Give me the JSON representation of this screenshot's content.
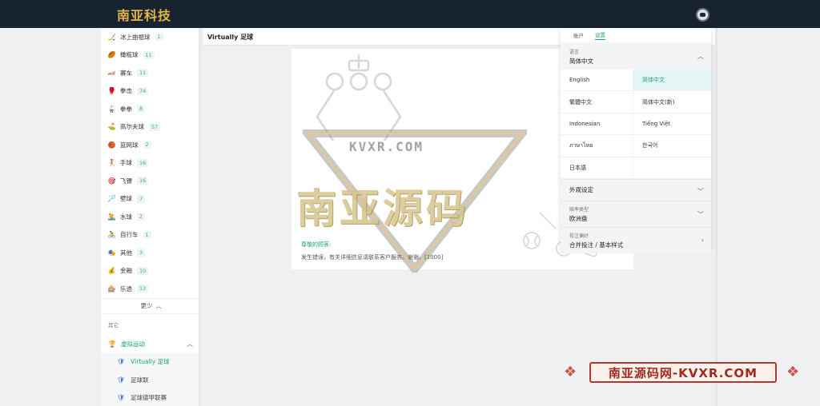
{
  "topbar": {
    "logo_text": "南亚科技",
    "avatar_icon": "robot-avatar-icon"
  },
  "sidebar": {
    "items": [
      {
        "icon": "hockey-icon",
        "glyph": "🏒",
        "label": "冰上曲棍球",
        "count": "1"
      },
      {
        "icon": "rugby-icon",
        "glyph": "🏉",
        "label": "橄榄球",
        "count": "11"
      },
      {
        "icon": "racing-icon",
        "glyph": "🏎",
        "label": "赛车",
        "count": "11"
      },
      {
        "icon": "boxing-icon",
        "glyph": "🥊",
        "label": "拳击",
        "count": "74"
      },
      {
        "icon": "martial-arts-icon",
        "glyph": "🥋",
        "label": "拳拳",
        "count": "8"
      },
      {
        "icon": "golf-icon",
        "glyph": "⛳",
        "label": "高尔夫球",
        "count": "57"
      },
      {
        "icon": "netball-icon",
        "glyph": "🏀",
        "label": "篮网球",
        "count": "2"
      },
      {
        "icon": "handball-icon",
        "glyph": "🤾",
        "label": "手球",
        "count": "16"
      },
      {
        "icon": "darts-icon",
        "glyph": "🎯",
        "label": "飞镖",
        "count": "16"
      },
      {
        "icon": "squash-icon",
        "glyph": "🏸",
        "label": "壁球",
        "count": "7"
      },
      {
        "icon": "water-polo-icon",
        "glyph": "🤽",
        "label": "水球",
        "count": "2"
      },
      {
        "icon": "cycling-icon",
        "glyph": "🚴",
        "label": "自行车",
        "count": "1"
      },
      {
        "icon": "other-sports-icon",
        "glyph": "🎭",
        "label": "其他",
        "count": "3"
      },
      {
        "icon": "finance-icon",
        "glyph": "💰",
        "label": "金融",
        "count": "10"
      },
      {
        "icon": "lottery-icon",
        "glyph": "🎰",
        "label": "乐透",
        "count": "13"
      }
    ],
    "more_label": "更少",
    "section_label": "其它",
    "virtual_label": "虚拟运动",
    "sub_items": [
      {
        "label": "Virtually 足球",
        "active": true
      },
      {
        "label": "足球联",
        "active": false
      },
      {
        "label": "足球德甲联赛",
        "active": false
      },
      {
        "label": "足球欧洲杯",
        "active": false
      }
    ]
  },
  "main": {
    "title": "Virtually 足球",
    "watermark_main": "南亚源码",
    "watermark_sub": "KVXR.COM",
    "notice_greeting": "尊敬的顾客:",
    "notice_body": "发生错误，有关详细信息请联系客户服务。谢谢。[1000]"
  },
  "settings_panel": {
    "tabs": [
      {
        "label": "账户",
        "active": false
      },
      {
        "label": "设置",
        "active": true
      }
    ],
    "language_label": "语言",
    "language_value": "简体中文",
    "languages": [
      {
        "label": "English",
        "selected": false
      },
      {
        "label": "简体中文",
        "selected": true
      },
      {
        "label": "繁體中文",
        "selected": false
      },
      {
        "label": "简体中文(新)",
        "selected": false
      },
      {
        "label": "Indonesian",
        "selected": false
      },
      {
        "label": "Tiếng Việt",
        "selected": false
      },
      {
        "label": "ภาษาไทย",
        "selected": false
      },
      {
        "label": "한국어",
        "selected": false
      },
      {
        "label": "日本語",
        "selected": false
      },
      {
        "label": "",
        "selected": false
      }
    ],
    "appearance_label": "外观设定",
    "odds_type_label": "赔率类型",
    "odds_type_value": "欧洲盘",
    "bet_pref_label": "投注偏好",
    "bet_pref_value": "合并投注 / 基本样式"
  },
  "brand_banner": {
    "text": "南亚源码网-KVXR.COM"
  },
  "colors": {
    "accent": "#1aa37a",
    "topbar": "#17242f",
    "brand": "#9e2a22"
  }
}
